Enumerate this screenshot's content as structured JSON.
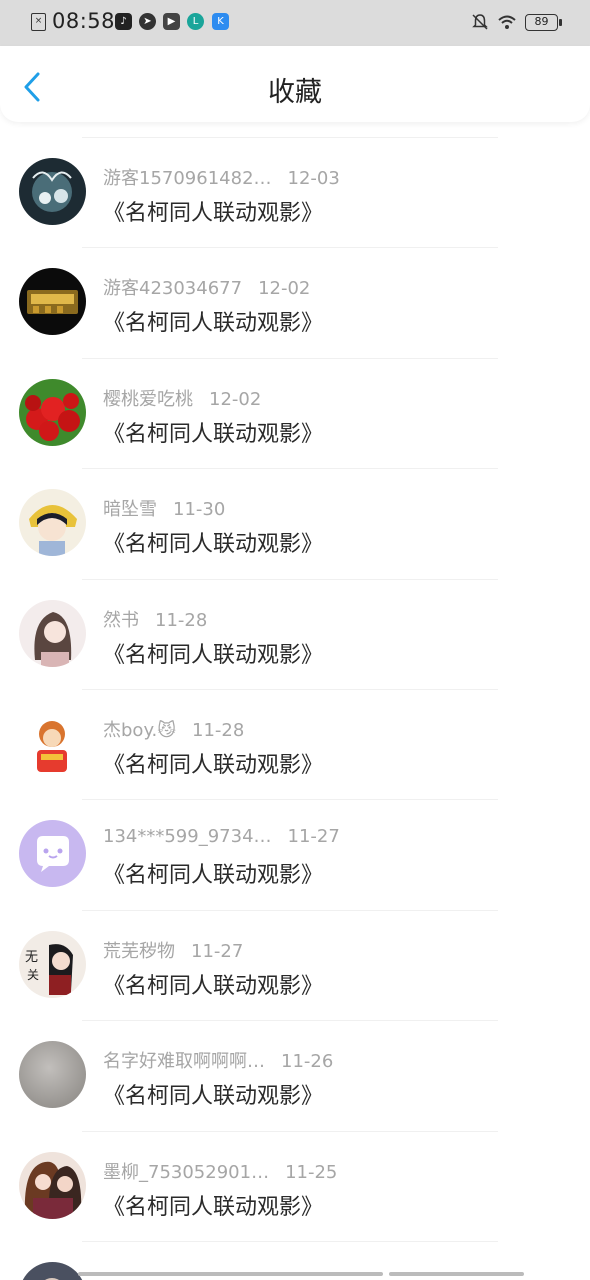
{
  "status_bar": {
    "time": "08:58",
    "sim_icon": "sim-card-icon",
    "notification_icons": [
      "tiktok-icon",
      "compass-icon",
      "media-icon",
      "app-l-icon",
      "app-k-icon"
    ],
    "battery_level": "89"
  },
  "header": {
    "title": "收藏",
    "back_icon": "chevron-left-icon",
    "accent_color": "#1f9fe8"
  },
  "favorites": [
    {
      "name": "游客1570961482…",
      "date": "12-03",
      "title": "《名柯同人联动观影》"
    },
    {
      "name": "游客423034677",
      "date": "12-02",
      "title": "《名柯同人联动观影》"
    },
    {
      "name": "樱桃爱吃桃",
      "date": "12-02",
      "title": "《名柯同人联动观影》"
    },
    {
      "name": "暗坠雪",
      "date": "11-30",
      "title": "《名柯同人联动观影》"
    },
    {
      "name": "然书",
      "date": "11-28",
      "title": "《名柯同人联动观影》"
    },
    {
      "name": "杰boy.😼",
      "date": "11-28",
      "title": "《名柯同人联动观影》"
    },
    {
      "name": "134***599_9734…",
      "date": "11-27",
      "title": "《名柯同人联动观影》"
    },
    {
      "name": "荒芜秽物",
      "date": "11-27",
      "title": "《名柯同人联动观影》"
    },
    {
      "name": "名字好难取啊啊啊…",
      "date": "11-26",
      "title": "《名柯同人联动观影》"
    },
    {
      "name": "墨柳_753052901…",
      "date": "11-25",
      "title": "《名柯同人联动观影》"
    }
  ]
}
